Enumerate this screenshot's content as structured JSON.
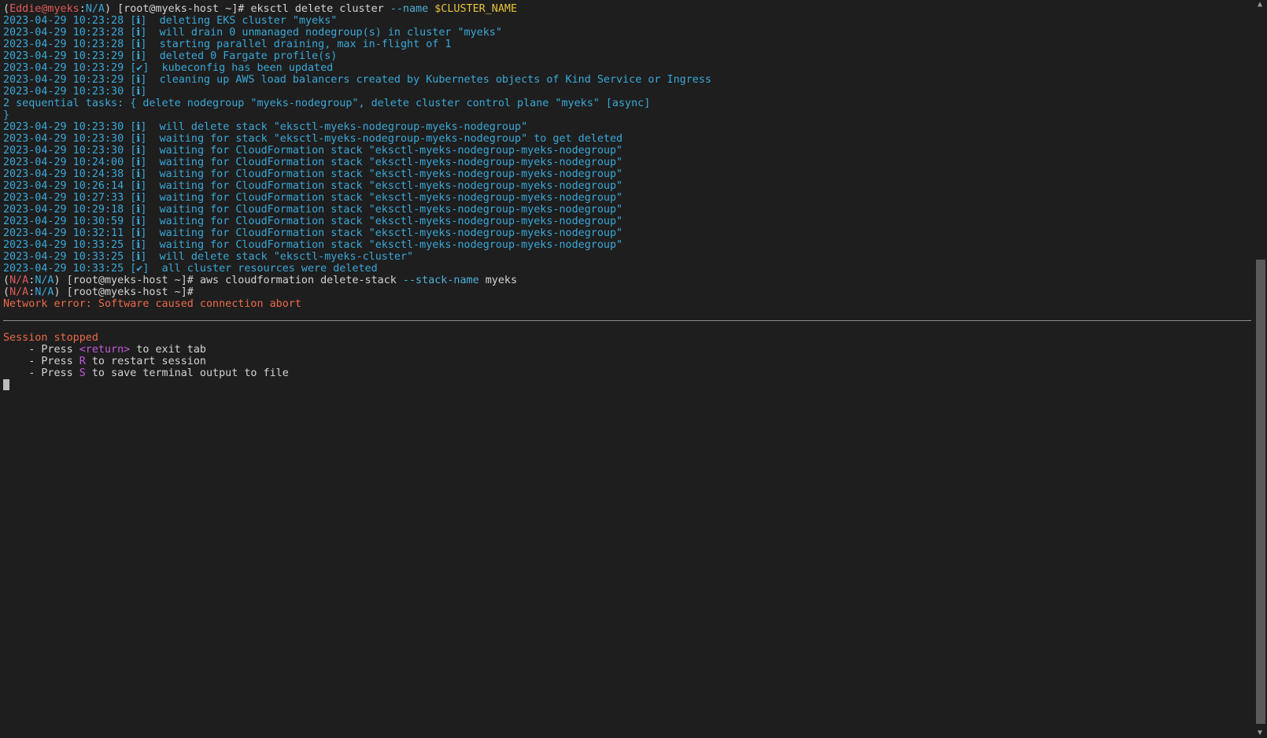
{
  "prompt1": {
    "open": "(",
    "user": "Eddie@myeks",
    "colon": ":",
    "ns": "N/A",
    "close": ")",
    "host": " [root@myeks-host ~]# ",
    "cmd": "eksctl delete cluster ",
    "flag": "--name ",
    "var": "$CLUSTER_NAME"
  },
  "log_lines_a": [
    {
      "ts": "2023-04-29 10:23:28",
      "mark": "[ℹ]",
      "msg": "deleting EKS cluster \"myeks\""
    },
    {
      "ts": "2023-04-29 10:23:28",
      "mark": "[ℹ]",
      "msg": "will drain 0 unmanaged nodegroup(s) in cluster \"myeks\""
    },
    {
      "ts": "2023-04-29 10:23:28",
      "mark": "[ℹ]",
      "msg": "starting parallel draining, max in-flight of 1"
    },
    {
      "ts": "2023-04-29 10:23:29",
      "mark": "[ℹ]",
      "msg": "deleted 0 Fargate profile(s)"
    },
    {
      "ts": "2023-04-29 10:23:29",
      "mark": "[✔]",
      "msg": "kubeconfig has been updated"
    },
    {
      "ts": "2023-04-29 10:23:29",
      "mark": "[ℹ]",
      "msg": "cleaning up AWS load balancers created by Kubernetes objects of Kind Service or Ingress"
    },
    {
      "ts": "2023-04-29 10:23:30",
      "mark": "[ℹ]",
      "msg": ""
    }
  ],
  "tasks_line": "2 sequential tasks: { delete nodegroup \"myeks-nodegroup\", delete cluster control plane \"myeks\" [async]",
  "tasks_close": "}",
  "log_lines_b": [
    {
      "ts": "2023-04-29 10:23:30",
      "mark": "[ℹ]",
      "msg": "will delete stack \"eksctl-myeks-nodegroup-myeks-nodegroup\""
    },
    {
      "ts": "2023-04-29 10:23:30",
      "mark": "[ℹ]",
      "msg": "waiting for stack \"eksctl-myeks-nodegroup-myeks-nodegroup\" to get deleted"
    },
    {
      "ts": "2023-04-29 10:23:30",
      "mark": "[ℹ]",
      "msg": "waiting for CloudFormation stack \"eksctl-myeks-nodegroup-myeks-nodegroup\""
    },
    {
      "ts": "2023-04-29 10:24:00",
      "mark": "[ℹ]",
      "msg": "waiting for CloudFormation stack \"eksctl-myeks-nodegroup-myeks-nodegroup\""
    },
    {
      "ts": "2023-04-29 10:24:38",
      "mark": "[ℹ]",
      "msg": "waiting for CloudFormation stack \"eksctl-myeks-nodegroup-myeks-nodegroup\""
    },
    {
      "ts": "2023-04-29 10:26:14",
      "mark": "[ℹ]",
      "msg": "waiting for CloudFormation stack \"eksctl-myeks-nodegroup-myeks-nodegroup\""
    },
    {
      "ts": "2023-04-29 10:27:33",
      "mark": "[ℹ]",
      "msg": "waiting for CloudFormation stack \"eksctl-myeks-nodegroup-myeks-nodegroup\""
    },
    {
      "ts": "2023-04-29 10:29:18",
      "mark": "[ℹ]",
      "msg": "waiting for CloudFormation stack \"eksctl-myeks-nodegroup-myeks-nodegroup\""
    },
    {
      "ts": "2023-04-29 10:30:59",
      "mark": "[ℹ]",
      "msg": "waiting for CloudFormation stack \"eksctl-myeks-nodegroup-myeks-nodegroup\""
    },
    {
      "ts": "2023-04-29 10:32:11",
      "mark": "[ℹ]",
      "msg": "waiting for CloudFormation stack \"eksctl-myeks-nodegroup-myeks-nodegroup\""
    },
    {
      "ts": "2023-04-29 10:33:25",
      "mark": "[ℹ]",
      "msg": "waiting for CloudFormation stack \"eksctl-myeks-nodegroup-myeks-nodegroup\""
    },
    {
      "ts": "2023-04-29 10:33:25",
      "mark": "[ℹ]",
      "msg": "will delete stack \"eksctl-myeks-cluster\""
    },
    {
      "ts": "2023-04-29 10:33:25",
      "mark": "[✔]",
      "msg": "all cluster resources were deleted"
    }
  ],
  "prompt2": {
    "open": "(",
    "user": "N/A",
    "colon": ":",
    "ns": "N/A",
    "close": ")",
    "host": " [root@myeks-host ~]# ",
    "cmd": "aws cloudformation delete-stack ",
    "flag": "--stack-name ",
    "arg": "myeks"
  },
  "prompt3": {
    "open": "(",
    "user": "N/A",
    "colon": ":",
    "ns": "N/A",
    "close": ")",
    "host": " [root@myeks-host ~]#"
  },
  "network_error": "Network error: Software caused connection abort",
  "session": {
    "stopped": "Session stopped",
    "bullet_prefix": "    - Press ",
    "opt1_key": "<return>",
    "opt1_rest": " to exit tab",
    "opt2_key": "R",
    "opt2_rest": " to restart session",
    "opt3_key": "S",
    "opt3_rest": " to save terminal output to file"
  },
  "scrollbar": {
    "up_icon": "▲",
    "down_icon": "▼"
  },
  "colors": {
    "background": "#1e1e1e",
    "log_text": "#3aa8d8",
    "error_text": "#ec6a4a",
    "highlight_key": "#c05ad8"
  }
}
